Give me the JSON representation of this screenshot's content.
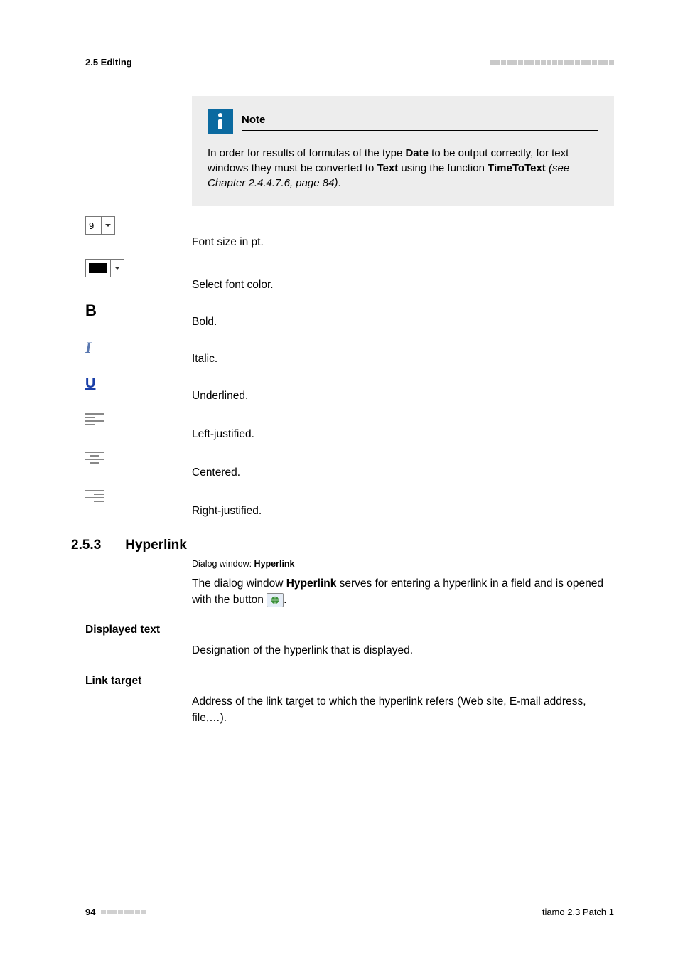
{
  "header": {
    "section": "2.5 Editing"
  },
  "note": {
    "title": "Note",
    "body_pre": "In order for results of formulas of the type ",
    "b1": "Date",
    "body_mid1": " to be output correctly, for text windows they must be converted to ",
    "b2": "Text",
    "body_mid2": " using the function ",
    "b3": "TimeToText",
    "body_post_italic": " (see Chapter 2.4.4.7.6, page 84)",
    "body_end": "."
  },
  "fontsize": {
    "value": "9",
    "desc": "Font size in pt."
  },
  "fontcolor": {
    "desc": "Select font color."
  },
  "bold": {
    "desc": "Bold."
  },
  "italic": {
    "desc": "Italic."
  },
  "underline": {
    "desc": "Underlined."
  },
  "left": {
    "desc": "Left-justified."
  },
  "center": {
    "desc": "Centered."
  },
  "right": {
    "desc": "Right-justified."
  },
  "hyperlink": {
    "number": "2.5.3",
    "title": "Hyperlink",
    "dlg_label": "Dialog window: ",
    "dlg_name": "Hyperlink",
    "para_pre": "The dialog window ",
    "para_b": "Hyperlink",
    "para_mid": " serves for entering a hyperlink in a field and is opened with the button ",
    "para_end": "."
  },
  "displayed_text": {
    "label": "Displayed text",
    "desc": "Designation of the hyperlink that is displayed."
  },
  "link_target": {
    "label": "Link target",
    "desc": "Address of the link target to which the hyperlink refers (Web site, E-mail address, file,…)."
  },
  "footer": {
    "page": "94",
    "product": "tiamo 2.3 Patch 1"
  }
}
